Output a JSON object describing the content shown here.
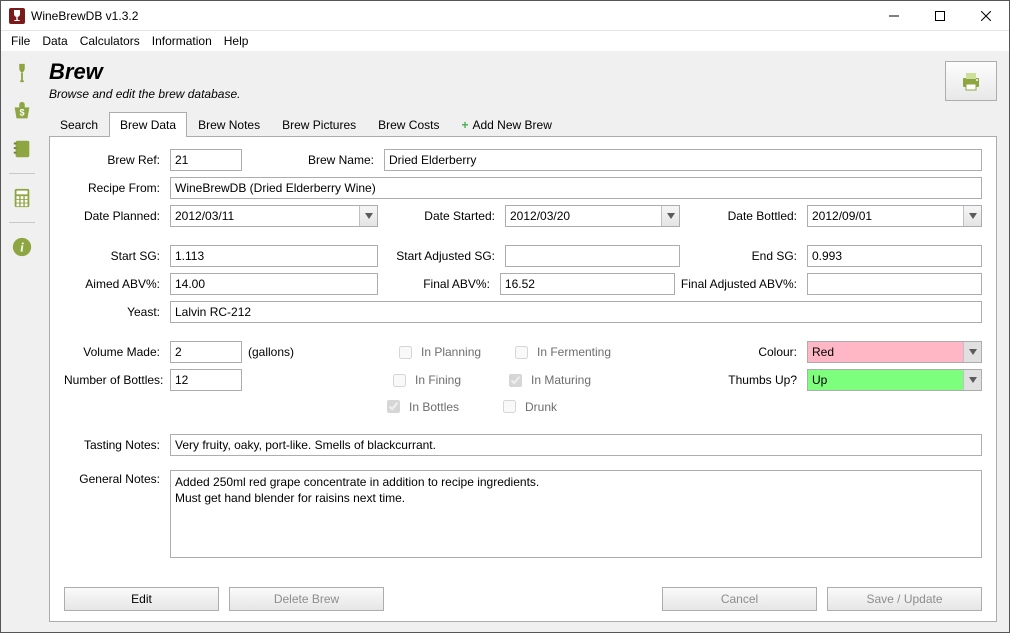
{
  "window": {
    "title": "WineBrewDB v1.3.2"
  },
  "menu": {
    "file": "File",
    "data": "Data",
    "calculators": "Calculators",
    "information": "Information",
    "help": "Help"
  },
  "header": {
    "title": "Brew",
    "subtitle": "Browse and edit the brew database."
  },
  "tabs": {
    "search": "Search",
    "brew_data": "Brew Data",
    "brew_notes": "Brew Notes",
    "brew_pictures": "Brew Pictures",
    "brew_costs": "Brew Costs",
    "add_new": "Add New Brew"
  },
  "form": {
    "labels": {
      "brew_ref": "Brew Ref:",
      "brew_name": "Brew Name:",
      "recipe_from": "Recipe From:",
      "date_planned": "Date Planned:",
      "date_started": "Date Started:",
      "date_bottled": "Date Bottled:",
      "start_sg": "Start SG:",
      "start_adj_sg": "Start Adjusted SG:",
      "end_sg": "End SG:",
      "aimed_abv": "Aimed ABV%:",
      "final_abv": "Final ABV%:",
      "final_adj_abv": "Final Adjusted ABV%:",
      "yeast": "Yeast:",
      "volume_made": "Volume Made:",
      "gallons": "(gallons)",
      "num_bottles": "Number of Bottles:",
      "colour": "Colour:",
      "thumbs": "Thumbs Up?",
      "tasting": "Tasting Notes:",
      "general": "General Notes:"
    },
    "checkboxes": {
      "in_planning": "In Planning",
      "in_fermenting": "In Fermenting",
      "in_fining": "In Fining",
      "in_maturing": "In Maturing",
      "in_bottles": "In Bottles",
      "drunk": "Drunk"
    },
    "values": {
      "brew_ref": "21",
      "brew_name": "Dried Elderberry",
      "recipe_from": "WineBrewDB (Dried Elderberry Wine)",
      "date_planned": "2012/03/11",
      "date_started": "2012/03/20",
      "date_bottled": "2012/09/01",
      "start_sg": "1.113",
      "start_adj_sg": "",
      "end_sg": "0.993",
      "aimed_abv": "14.00",
      "final_abv": "16.52",
      "final_adj_abv": "",
      "yeast": "Lalvin RC-212",
      "volume_made": "2",
      "num_bottles": "12",
      "colour": "Red",
      "thumbs": "Up",
      "tasting": "Very fruity, oaky, port-like. Smells of blackcurrant.",
      "general": "Added 250ml red grape concentrate in addition to recipe ingredients.\nMust get hand blender for raisins next time."
    }
  },
  "buttons": {
    "edit": "Edit",
    "delete": "Delete Brew",
    "cancel": "Cancel",
    "save": "Save / Update"
  }
}
